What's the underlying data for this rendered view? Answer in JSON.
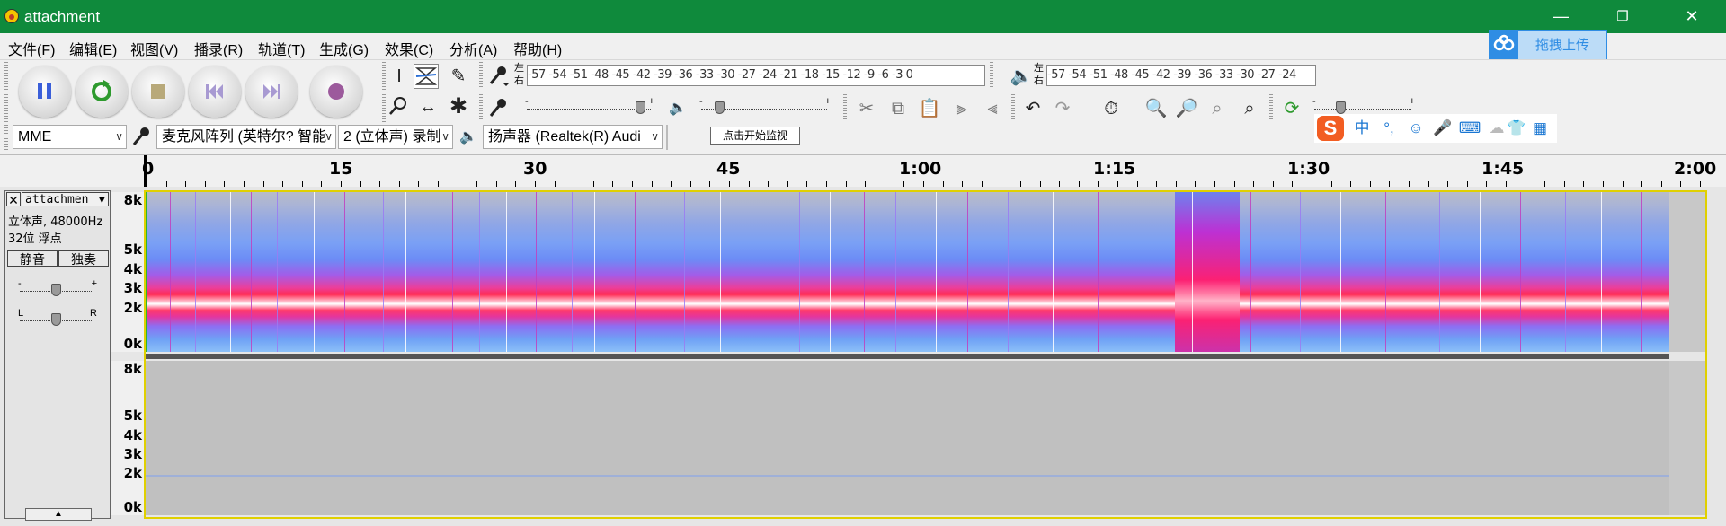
{
  "window": {
    "title": "attachment",
    "controls": {
      "minimize": "—",
      "restore": "❐",
      "close": "✕"
    }
  },
  "menu": [
    "文件(F)",
    "编辑(E)",
    "视图(V)",
    "播录(R)",
    "轨道(T)",
    "生成(G)",
    "效果(C)",
    "分析(A)",
    "帮助(H)"
  ],
  "baidu_plugin": {
    "label": "拖拽上传"
  },
  "transport": {
    "buttons": [
      "pause",
      "loop",
      "stop",
      "skip-to-start",
      "skip-to-end",
      "record"
    ]
  },
  "meters": {
    "record_scale": "-57 -54 -51 -48 -45 -42 -39 -36 -33 -30 -27 -24 -21 -18 -15 -12  -9  -6  -3  0",
    "record_tip": "点击开始监视",
    "play_scale": "-57 -54 -51 -48 -45 -42 -39 -36 -33 -30 -27 -24",
    "lr_top": "左",
    "lr_bottom": "右"
  },
  "sliders": {
    "record_volume": 0.95,
    "playback_volume": 0.12,
    "play_speed": 0.25
  },
  "ime_bar": {
    "brand": "S",
    "lang": "中",
    "punct": "°,",
    "emoji": "☺",
    "voice": "🎤",
    "keyboard": "⌨",
    "skin": "👕",
    "menu": "▦"
  },
  "device": {
    "host": "MME",
    "input": "麦克风阵列 (英特尔? 智能",
    "channels": "2 (立体声) 录制",
    "output": "扬声器 (Realtek(R) Audi"
  },
  "ruler": {
    "labels": [
      "0",
      "15",
      "30",
      "45",
      "1:00",
      "1:15",
      "1:30",
      "1:45",
      "2:00"
    ]
  },
  "track": {
    "name": "attachmen",
    "info_line1": "立体声, 48000Hz",
    "info_line2": "32位 浮点",
    "mute": "静音",
    "solo": "独奏",
    "collapse": "▲"
  },
  "freq_axis": {
    "labels": [
      "8k",
      "5k",
      "4k",
      "3k",
      "2k",
      "0k"
    ]
  }
}
